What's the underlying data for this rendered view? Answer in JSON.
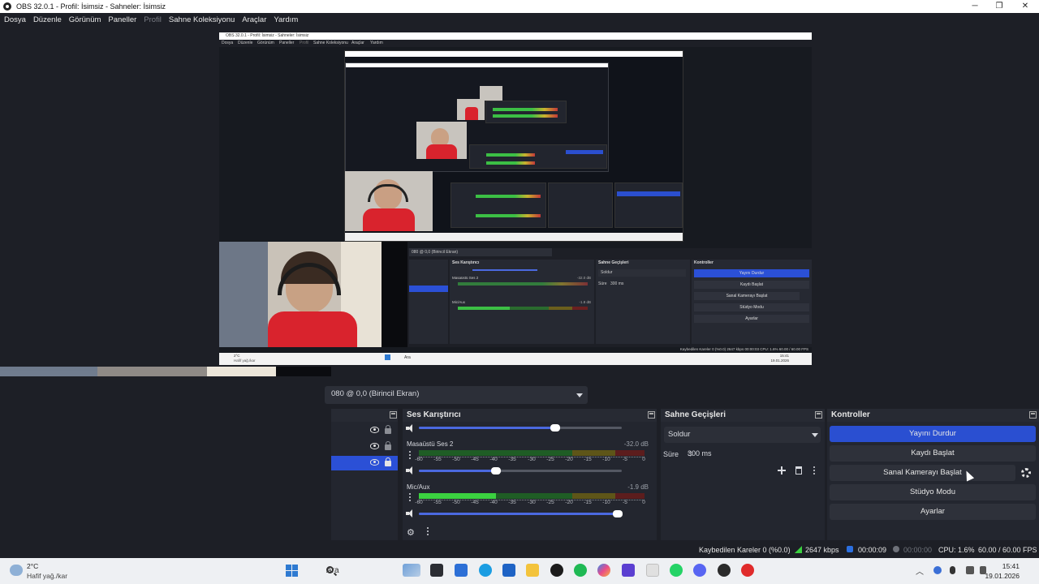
{
  "window": {
    "title": "OBS 32.0.1 - Profil: İsimsiz - Sahneler: İsimsiz",
    "minimize": "─",
    "maximize": "❐",
    "close": "✕"
  },
  "menu": {
    "items": [
      "Dosya",
      "Düzenle",
      "Görünüm",
      "Paneller",
      "Profil",
      "Sahne Koleksiyonu",
      "Araçlar",
      "Yardım"
    ]
  },
  "preview": {
    "nested_title": "OBS 32.0.1 - Profil: İsimsiz - Sahneler: İsimsiz",
    "nested_menu": [
      "Dosya",
      "Düzenle",
      "Görünüm",
      "Paneller",
      "Profil",
      "Sahne Koleksiyonu",
      "Araçlar",
      "Yardım"
    ],
    "nested_source": "080 @ 0,0 (Birincil Ekran)",
    "nested_mixer": "Ses Karıştırıcı",
    "nested_desktop": "Masaüstü Ses 2",
    "nested_desktop_db": "-32.0 dB",
    "nested_mic": "Mic/Aux",
    "nested_mic_db": "-1.8 dB",
    "nested_trans": "Sahne Geçişleri",
    "nested_trans_value": "Soldur",
    "nested_dur_label": "Süre",
    "nested_dur_value": "300 ms",
    "nested_controls": "Kontroller",
    "nested_buttons": [
      "Yayını Durdur",
      "Kaydı Başlat",
      "Sanal Kamerayı Başlat",
      "Stüdyo Modu",
      "Ayarlar"
    ],
    "nested_status": "Kaybedilen Kareler 0 (%0.0)   2647 kbps   00:00:03   CPU: 1.6%   60.00 / 60.00 FPS",
    "nested_weather": "2°C",
    "nested_weather_desc": "Hafif yağ./kar",
    "nested_search": "Ara",
    "nested_clock_time": "15:41",
    "nested_clock_date": "19.01.2026"
  },
  "sources": {
    "select_value": "080 @ 0,0 (Birincil Ekran)",
    "rows": [
      {
        "selected": false
      },
      {
        "selected": false
      },
      {
        "selected": true
      }
    ]
  },
  "mixer": {
    "title": "Ses Karıştırıcı",
    "tick_labels": [
      "-60",
      "-55",
      "-50",
      "-45",
      "-40",
      "-35",
      "-30",
      "-25",
      "-20",
      "-15",
      "-10",
      "-5",
      "0"
    ],
    "channels": [
      {
        "name": "",
        "db": "",
        "level": 0,
        "volume": 0.67
      },
      {
        "name": "Masaüstü Ses 2",
        "db": "-32.0 dB",
        "level": 0,
        "volume": 0.38
      },
      {
        "name": "Mic/Aux",
        "db": "-1.9 dB",
        "level": 0.34,
        "volume": 0.98
      }
    ]
  },
  "transitions": {
    "title": "Sahne Geçişleri",
    "value": "Soldur",
    "duration_label": "Süre",
    "duration_value": "300 ms"
  },
  "controls": {
    "title": "Kontroller",
    "buttons": [
      {
        "label": "Yayını Durdur",
        "active": true
      },
      {
        "label": "Kaydı Başlat",
        "active": false
      },
      {
        "label": "Sanal Kamerayı Başlat",
        "active": false
      },
      {
        "label": "Stüdyo Modu",
        "active": false
      },
      {
        "label": "Ayarlar",
        "active": false
      }
    ]
  },
  "status": {
    "dropped": "Kaybedilen Kareler 0 (%0.0)",
    "bitrate": "2647 kbps",
    "stream_time": "00:00:09",
    "record_time": "00:00:00",
    "cpu": "CPU: 1.6%",
    "fps": "60.00 / 60.00 FPS"
  },
  "taskbar": {
    "weather_temp": "2°C",
    "weather_desc": "Hafif yağ./kar",
    "search": "Ara",
    "clock_time": "15:41",
    "clock_date": "19.01.2026",
    "apps": [
      "task-view",
      "terminal",
      "store",
      "edge",
      "downloads",
      "explorer",
      "github",
      "spotify",
      "copilot",
      "visual-studio",
      "pdf",
      "whatsapp",
      "discord",
      "obs",
      "app-red"
    ]
  },
  "colors": {
    "accent": "#2a4fd1",
    "background": "#1d1f26",
    "panel": "#23262f",
    "meter_green": "#3bd140",
    "meter_yellow": "#c9b32e",
    "meter_red": "#c23838"
  }
}
